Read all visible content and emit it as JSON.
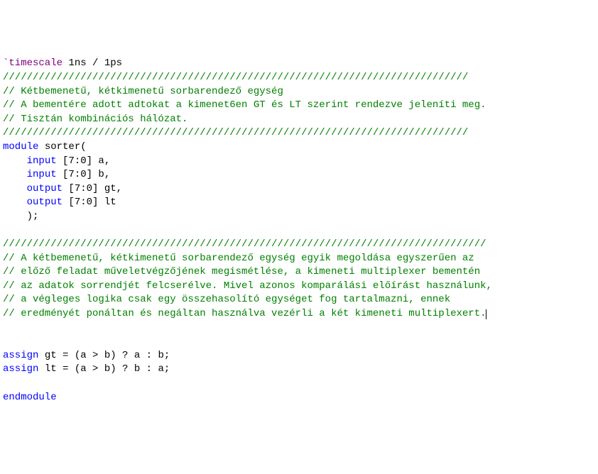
{
  "code": {
    "lines": [
      {
        "tokens": [
          {
            "cls": "tk-directive",
            "t": "`timescale"
          },
          {
            "cls": "tk-default",
            "t": " 1ns / 1ps"
          }
        ]
      },
      {
        "tokens": [
          {
            "cls": "tk-comment",
            "t": "//////////////////////////////////////////////////////////////////////////////"
          }
        ]
      },
      {
        "tokens": [
          {
            "cls": "tk-comment",
            "t": "// Kétbemenetű, kétkimenetű sorbarendező egység"
          }
        ]
      },
      {
        "tokens": [
          {
            "cls": "tk-comment",
            "t": "// A bementére adott adtokat a kimenet6en GT és LT szerint rendezve jeleníti meg."
          }
        ]
      },
      {
        "tokens": [
          {
            "cls": "tk-comment",
            "t": "// Tisztán kombinációs hálózat."
          }
        ]
      },
      {
        "tokens": [
          {
            "cls": "tk-comment",
            "t": "//////////////////////////////////////////////////////////////////////////////"
          }
        ]
      },
      {
        "tokens": [
          {
            "cls": "tk-keyword",
            "t": "module"
          },
          {
            "cls": "tk-default",
            "t": " sorter("
          }
        ]
      },
      {
        "tokens": [
          {
            "cls": "tk-default",
            "t": "    "
          },
          {
            "cls": "tk-keyword",
            "t": "input"
          },
          {
            "cls": "tk-default",
            "t": " [7:0] a,"
          }
        ]
      },
      {
        "tokens": [
          {
            "cls": "tk-default",
            "t": "    "
          },
          {
            "cls": "tk-keyword",
            "t": "input"
          },
          {
            "cls": "tk-default",
            "t": " [7:0] b,"
          }
        ]
      },
      {
        "tokens": [
          {
            "cls": "tk-default",
            "t": "    "
          },
          {
            "cls": "tk-keyword",
            "t": "output"
          },
          {
            "cls": "tk-default",
            "t": " [7:0] gt,"
          }
        ]
      },
      {
        "tokens": [
          {
            "cls": "tk-default",
            "t": "    "
          },
          {
            "cls": "tk-keyword",
            "t": "output"
          },
          {
            "cls": "tk-default",
            "t": " [7:0] lt"
          }
        ]
      },
      {
        "tokens": [
          {
            "cls": "tk-default",
            "t": "    );"
          }
        ]
      },
      {
        "tokens": [
          {
            "cls": "tk-default",
            "t": ""
          }
        ]
      },
      {
        "tokens": [
          {
            "cls": "tk-comment",
            "t": "/////////////////////////////////////////////////////////////////////////////////"
          }
        ]
      },
      {
        "tokens": [
          {
            "cls": "tk-comment",
            "t": "// A kétbemenetű, kétkimenetű sorbarendező egység egyik megoldása egyszerűen az"
          }
        ]
      },
      {
        "tokens": [
          {
            "cls": "tk-comment",
            "t": "// előző feladat műveletvégzőjének megismétlése, a kimeneti multiplexer bementén"
          }
        ]
      },
      {
        "tokens": [
          {
            "cls": "tk-comment",
            "t": "// az adatok sorrendjét felcserélve. Mivel azonos komparálási előírást használunk,"
          }
        ]
      },
      {
        "tokens": [
          {
            "cls": "tk-comment",
            "t": "// a végleges logika csak egy összehasolító egységet fog tartalmazni, ennek"
          }
        ]
      },
      {
        "tokens": [
          {
            "cls": "tk-comment",
            "t": "// eredményét ponáltan és negáltan használva vezérli a két kimeneti multiplexert."
          }
        ],
        "cursor": true
      },
      {
        "tokens": [
          {
            "cls": "tk-default",
            "t": ""
          }
        ]
      },
      {
        "tokens": [
          {
            "cls": "tk-default",
            "t": ""
          }
        ]
      },
      {
        "tokens": [
          {
            "cls": "tk-keyword",
            "t": "assign"
          },
          {
            "cls": "tk-default",
            "t": " gt = (a > b) ? a : b;"
          }
        ]
      },
      {
        "tokens": [
          {
            "cls": "tk-keyword",
            "t": "assign"
          },
          {
            "cls": "tk-default",
            "t": " lt = (a > b) ? b : a;"
          }
        ]
      },
      {
        "tokens": [
          {
            "cls": "tk-default",
            "t": ""
          }
        ]
      },
      {
        "tokens": [
          {
            "cls": "tk-keyword",
            "t": "endmodule"
          }
        ]
      }
    ]
  }
}
